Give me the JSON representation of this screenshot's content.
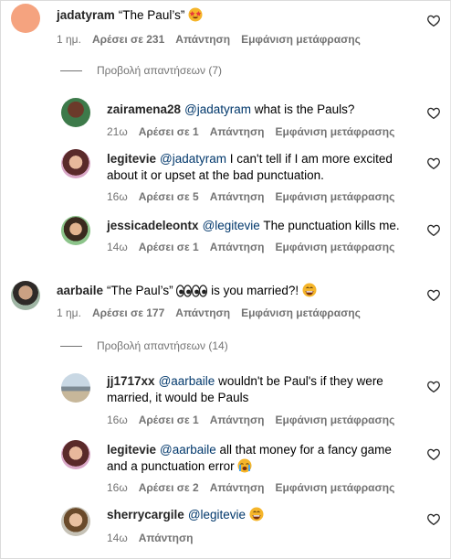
{
  "comments": [
    {
      "user": "jadatyram",
      "text_pre": "“The Paul’s” ",
      "mention": "",
      "text": "",
      "emoji": "star-struck",
      "time": "1 ημ.",
      "likes": "Αρέσει σε 231",
      "reply": "Απάντηση",
      "translate": "Εμφάνιση μετάφρασης"
    },
    {
      "user": "zairamena28",
      "mention": "@jadatyram",
      "text": " what is the Pauls?",
      "time": "21ω",
      "likes": "Αρέσει σε 1",
      "reply": "Απάντηση",
      "translate": "Εμφάνιση μετάφρασης"
    },
    {
      "user": "legitevie",
      "mention": "@jadatyram",
      "text": " I can't tell if I am more excited",
      "text2": "about it or upset at the bad punctuation.",
      "time": "16ω",
      "likes": "Αρέσει σε 5",
      "reply": "Απάντηση",
      "translate": "Εμφάνιση μετάφρασης"
    },
    {
      "user": "jessicadeleontx",
      "mention": "@legitevie",
      "text": " The punctuation kills me.",
      "time": "14ω",
      "likes": "Αρέσει σε 1",
      "reply": "Απάντηση",
      "translate": "Εμφάνιση μετάφρασης"
    },
    {
      "user": "aarbaile",
      "text_pre": "“The Paul’s” ",
      "text_post": " is you married?! ",
      "time": "1 ημ.",
      "likes": "Αρέσει σε 177",
      "reply": "Απάντηση",
      "translate": "Εμφάνιση μετάφρασης"
    },
    {
      "user": "jj1717xx",
      "mention": "@aarbaile",
      "text": " wouldn't be Paul's if they were",
      "text2": "married, it would be Pauls",
      "time": "16ω",
      "likes": "Αρέσει σε 1",
      "reply": "Απάντηση",
      "translate": "Εμφάνιση μετάφρασης"
    },
    {
      "user": "legitevie",
      "mention": "@aarbaile",
      "text": " all that money for a fancy game",
      "text2": "and a punctuation error ",
      "time": "16ω",
      "likes": "Αρέσει σε 2",
      "reply": "Απάντηση",
      "translate": "Εμφάνιση μετάφρασης"
    },
    {
      "user": "sherrycargile",
      "mention": "@legitevie",
      "text": " ",
      "time": "14ω",
      "reply": "Απάντηση"
    }
  ],
  "view_replies": [
    "Προβολή απαντήσεων (7)",
    "Προβολή απαντήσεων (14)"
  ],
  "icons": {
    "heart": "heart-outline-icon",
    "star_struck": "star-struck-emoji",
    "eyes": "eyes-emoji",
    "laughing": "grinning-sweat-emoji",
    "crying": "crying-emoji"
  },
  "colors": {
    "meta": "#737373",
    "mention": "#00376b",
    "text": "#262626"
  }
}
